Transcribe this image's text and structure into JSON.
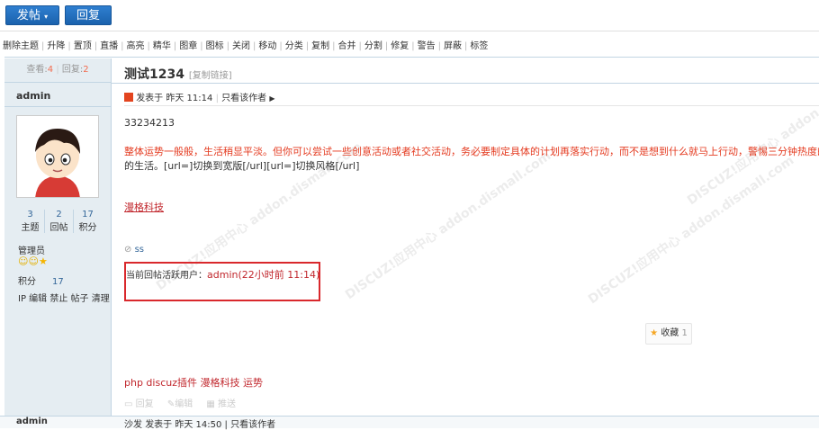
{
  "top_buttons": {
    "post": "发帖",
    "reply": "回复"
  },
  "toolbar_items": [
    "删除主题",
    "升降",
    "置顶",
    "直播",
    "高亮",
    "精华",
    "图章",
    "图标",
    "关闭",
    "移动",
    "分类",
    "复制",
    "合并",
    "分割",
    "修复",
    "警告",
    "屏蔽",
    "标签"
  ],
  "stats": {
    "views_label": "查看:",
    "views": "4",
    "replies_label": "回复:",
    "replies": "2"
  },
  "thread": {
    "title": "测试1234",
    "copy_link": "[复制链接]"
  },
  "post": {
    "author": "admin",
    "posted": "发表于 昨天 11:14",
    "only_author": "只看该作者",
    "line1": "33234213",
    "line2_red": "整体运势一般般，生活稍显平淡。但你可以尝试一些创意活动或者社交活动，务必要制定具体的计划再落实行动，而不是想到什么就马上行动，警惕三分钟热度的情况，可以",
    "line3": "的生活。[url=]切换到宽版[/url][url=]切换风格[/url]",
    "link_text": "漫格科技",
    "tag": "ss",
    "active_label": "当前回帖活跃用户：",
    "active_user": "admin(22小时前 11:14)",
    "fav_label": "收藏",
    "fav_count": "1",
    "tags_line": "php discuz插件 漫格科技 运势",
    "actions": [
      "回复",
      "编辑",
      "推送"
    ]
  },
  "user": {
    "threads": "3",
    "threads_label": "主题",
    "posts": "2",
    "posts_label": "回帖",
    "credits": "17",
    "credits_label": "积分",
    "group": "管理员",
    "credit_label": "积分",
    "credit_value": "17",
    "admin_links": "IP 编辑 禁止 帖子 清理"
  },
  "next_post": {
    "author": "admin",
    "meta": "发表于 昨天 14:50 | 只看该作者",
    "floor": "沙发"
  },
  "watermark": "DISCUZ!应用中心 addon.dismall.com"
}
